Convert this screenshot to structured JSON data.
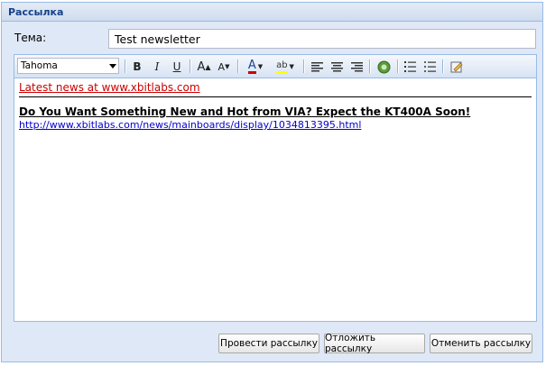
{
  "panel": {
    "title": "Рассылка"
  },
  "subject": {
    "label": "Тема:",
    "value": "Test newsletter"
  },
  "toolbar": {
    "font": "Tahoma",
    "buttons": {
      "bold": "B",
      "italic": "I",
      "underline": "U",
      "grow": "A",
      "shrink": "A",
      "font_color": "A",
      "highlight": "ab"
    },
    "icons": [
      "bold-icon",
      "italic-icon",
      "underline-icon",
      "increase-font-icon",
      "decrease-font-icon",
      "font-color-icon",
      "highlight-icon",
      "align-left-icon",
      "align-center-icon",
      "align-right-icon",
      "insert-link-icon",
      "ordered-list-icon",
      "unordered-list-icon",
      "source-edit-icon"
    ],
    "colors": {
      "font_color": "#cc0000",
      "highlight": "#ffff00"
    }
  },
  "content": {
    "line1": "Latest news at www.xbitlabs.com",
    "headline": "Do You Want Something New and Hot from VIA? Expect the KT400A Soon!",
    "link": "http://www.xbitlabs.com/news/mainboards/display/1034813395.html"
  },
  "buttons": {
    "send": "Провести рассылку",
    "postpone": "Отложить рассылку",
    "cancel": "Отменить рассылку"
  }
}
